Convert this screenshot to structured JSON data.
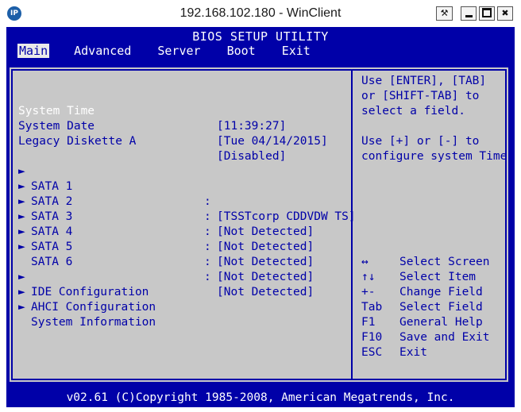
{
  "window": {
    "title": "192.168.102.180 - WinClient",
    "icon": "ip-icon",
    "buttons": [
      "pin",
      "minimize",
      "maximize",
      "close"
    ]
  },
  "bios": {
    "title": "BIOS SETUP UTILITY",
    "menu": [
      "Main",
      "Advanced",
      "Server",
      "Boot",
      "Exit"
    ],
    "active_menu": "Main",
    "settings": [
      {
        "label": "System Time",
        "value": "[11:39:27]"
      },
      {
        "label": "System Date",
        "value": "[Tue 04/14/2015]"
      },
      {
        "label": "Legacy Diskette A",
        "value": "[Disabled]"
      }
    ],
    "sata": [
      {
        "label": "SATA 1",
        "value": "[TSSTcorp CDDVDW TS]"
      },
      {
        "label": "SATA 2",
        "value": "[Not Detected]"
      },
      {
        "label": "SATA 3",
        "value": "[Not Detected]"
      },
      {
        "label": "SATA 4",
        "value": "[Not Detected]"
      },
      {
        "label": "SATA 5",
        "value": "[Not Detected]"
      },
      {
        "label": "SATA 6",
        "value": "[Not Detected]"
      }
    ],
    "submenus": [
      "IDE Configuration",
      "AHCI Configuration",
      "System Information"
    ],
    "help_text": [
      "Use [ENTER], [TAB]",
      "or [SHIFT-TAB] to",
      "select a field.",
      "",
      "Use [+] or [-] to",
      "configure system Time."
    ],
    "keys": [
      {
        "key": "↔",
        "desc": "Select Screen"
      },
      {
        "key": "↑↓",
        "desc": "Select Item"
      },
      {
        "key": "+-",
        "desc": "Change Field"
      },
      {
        "key": "Tab",
        "desc": "Select Field"
      },
      {
        "key": "F1",
        "desc": "General Help"
      },
      {
        "key": "F10",
        "desc": "Save and Exit"
      },
      {
        "key": "ESC",
        "desc": "Exit"
      }
    ],
    "footer": "v02.61 (C)Copyright 1985-2008, American Megatrends, Inc.",
    "colors": {
      "blue": "#0000a8",
      "panel": "#c8c8c8",
      "highlight": "#ffffff"
    }
  }
}
